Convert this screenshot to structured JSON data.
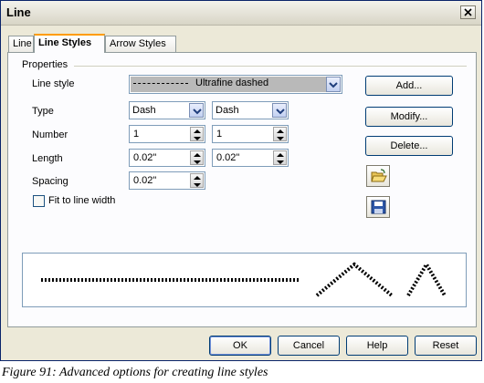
{
  "window": {
    "title": "Line"
  },
  "tabs": [
    {
      "label": "Line"
    },
    {
      "label": "Line Styles"
    },
    {
      "label": "Arrow Styles"
    }
  ],
  "properties": {
    "group_label": "Properties",
    "line_style_label": "Line style",
    "line_style_value": "Ultrafine dashed",
    "type_label": "Type",
    "type1": "Dash",
    "type2": "Dash",
    "number_label": "Number",
    "number1": "1",
    "number2": "1",
    "length_label": "Length",
    "length1": "0.02\"",
    "length2": "0.02\"",
    "spacing_label": "Spacing",
    "spacing": "0.02\"",
    "fit_label": "Fit to line width",
    "fit_checked": false
  },
  "side_buttons": {
    "add": "Add...",
    "modify": "Modify...",
    "delete": "Delete..."
  },
  "icons": {
    "load": "open-folder-icon",
    "save": "floppy-disk-icon"
  },
  "footer_buttons": {
    "ok": "OK",
    "cancel": "Cancel",
    "help": "Help",
    "reset": "Reset"
  },
  "caption": "Figure 91: Advanced options for creating line styles"
}
